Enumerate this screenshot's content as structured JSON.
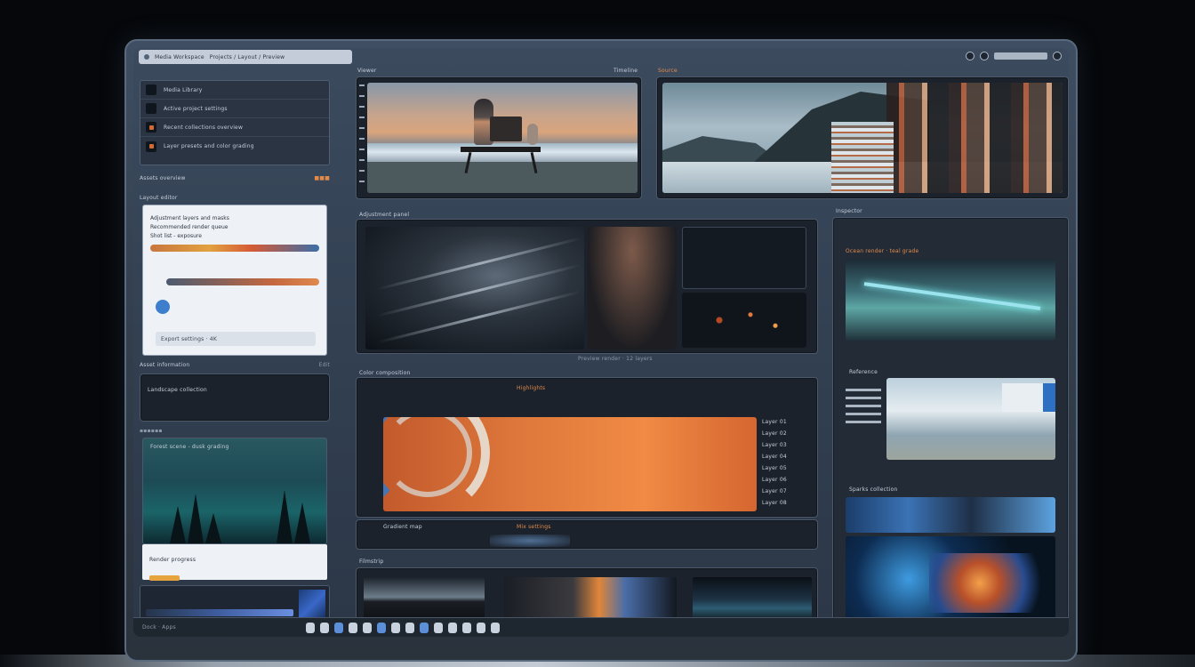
{
  "window": {
    "title": "Media Workspace",
    "subtitle": "Projects / Layout / Preview"
  },
  "left": {
    "menu": [
      {
        "label": "Media Library"
      },
      {
        "label": "Active project settings"
      },
      {
        "label": "Recent collections overview"
      },
      {
        "label": "Layer presets and color grading"
      }
    ],
    "section_label": "Assets overview",
    "card_header": "Layout editor",
    "card_lines": [
      "Adjustment layers and masks",
      "Recommended render queue",
      "Shot list - exposure"
    ],
    "card_footer": "Export settings · 4K",
    "sub1": "Asset information",
    "sub1_right": "Edit",
    "sub2": "Landscape collection",
    "forest_label": "Forest scene - dusk grading",
    "strip_text": "Render progress"
  },
  "top": {
    "label_left": "Viewer",
    "label_right": "Source",
    "label_center": "Timeline"
  },
  "middle": {
    "header": "Adjustment panel",
    "status": "Preview render · 12 layers"
  },
  "orange_panel": {
    "header": "Color composition",
    "title": "Highlights",
    "footer_left": "Gradient map",
    "footer_mid": "Mix settings",
    "side_items": [
      "Layer 01",
      "Layer 02",
      "Layer 03",
      "Layer 04",
      "Layer 05",
      "Layer 06",
      "Layer 07",
      "Layer 08"
    ]
  },
  "right": {
    "header": "Inspector",
    "panel1_title": "Ocean render · teal grade",
    "panel2_title": "Reference",
    "panel3_title": "Sparks collection"
  },
  "thumbs": {
    "header": "Filmstrip"
  },
  "taskbar": {
    "left_text": "Dock · Apps"
  },
  "colors": {
    "accent": "#e07a3c",
    "blue_accent": "#3d7fcc",
    "frame": "#3f4e62"
  }
}
